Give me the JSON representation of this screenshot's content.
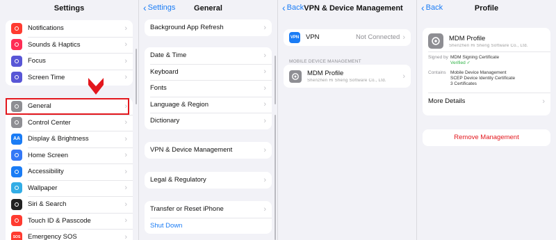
{
  "colors": {
    "accent": "#1a7cf5",
    "highlight": "#e3171d",
    "destructive": "#e3171d"
  },
  "panel1": {
    "title": "Settings",
    "group1": [
      {
        "label": "Notifications",
        "icon": "notifications-icon",
        "color": "#ff3b30"
      },
      {
        "label": "Sounds & Haptics",
        "icon": "sounds-icon",
        "color": "#ff2d55"
      },
      {
        "label": "Focus",
        "icon": "focus-moon-icon",
        "color": "#5856d6"
      },
      {
        "label": "Screen Time",
        "icon": "screen-time-icon",
        "color": "#5856d6"
      }
    ],
    "group2": [
      {
        "label": "General",
        "icon": "gear-icon",
        "color": "#8e8e93"
      },
      {
        "label": "Control Center",
        "icon": "control-center-icon",
        "color": "#8e8e93"
      },
      {
        "label": "Display & Brightness",
        "icon": "display-icon",
        "color": "#1a7cf5",
        "glyph": "AA"
      },
      {
        "label": "Home Screen",
        "icon": "home-screen-icon",
        "color": "#3478f6"
      },
      {
        "label": "Accessibility",
        "icon": "accessibility-icon",
        "color": "#1a7cf5"
      },
      {
        "label": "Wallpaper",
        "icon": "wallpaper-icon",
        "color": "#32ade6"
      },
      {
        "label": "Siri & Search",
        "icon": "siri-icon",
        "color": "#222222"
      },
      {
        "label": "Touch ID & Passcode",
        "icon": "touch-id-icon",
        "color": "#ff3b30"
      },
      {
        "label": "Emergency SOS",
        "icon": "sos-icon",
        "color": "#ff3b30",
        "glyph": "SOS"
      }
    ]
  },
  "panel2": {
    "back": "Settings",
    "title": "General",
    "group1": [
      "Background App Refresh"
    ],
    "group2": [
      "Date & Time",
      "Keyboard",
      "Fonts",
      "Language & Region",
      "Dictionary"
    ],
    "group3": [
      "VPN & Device Management"
    ],
    "group4": [
      "Legal & Regulatory"
    ],
    "group5": [
      "Transfer or Reset iPhone"
    ],
    "shutdown": "Shut Down"
  },
  "panel3": {
    "back": "Back",
    "title": "VPN & Device Management",
    "vpn_icon_text": "VPN",
    "vpn_label": "VPN",
    "vpn_status": "Not Connected",
    "section_label": "MOBILE DEVICE MANAGEMENT",
    "mdm_title": "MDM Profile",
    "mdm_sub": "Shenzhen Hi Sheng Software Co., Ltd."
  },
  "panel4": {
    "back": "Back",
    "title": "Profile",
    "profile_name": "MDM Profile",
    "profile_sub": "Shenzhen Hi Sheng Software Co., Ltd.",
    "signed_by_label": "Signed by",
    "signed_by_value": "MDM Signing Certificate",
    "verified": "Verified",
    "contains_label": "Contains",
    "contains_values": [
      "Mobile Device Management",
      "SCEP Device Identity Certificate",
      "3 Certificates"
    ],
    "more_details": "More Details",
    "remove": "Remove Management"
  }
}
